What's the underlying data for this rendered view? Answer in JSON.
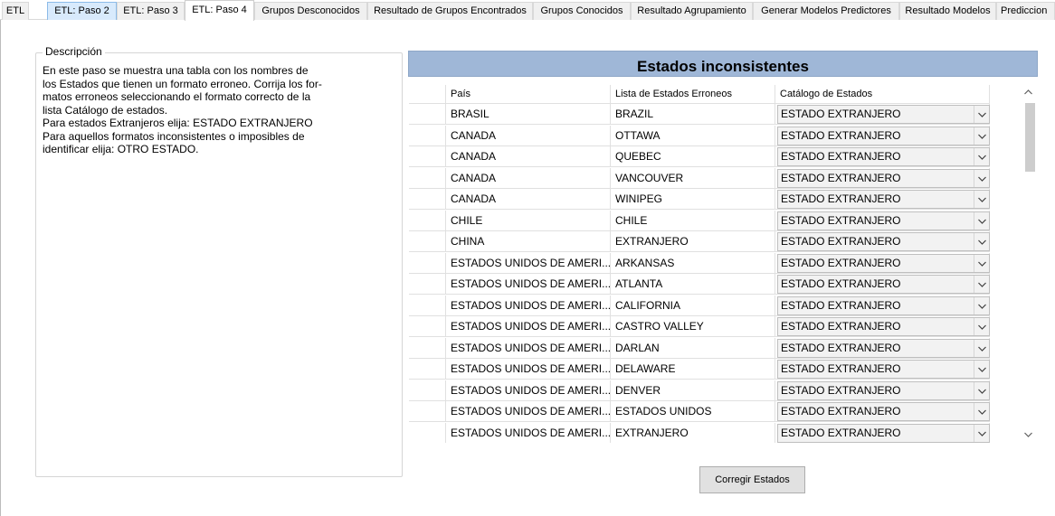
{
  "tabs": [
    {
      "label": "ETL"
    },
    {
      "label": "ETL: Paso 2"
    },
    {
      "label": "ETL: Paso 3"
    },
    {
      "label": "ETL: Paso 4"
    },
    {
      "label": "Grupos Desconocidos"
    },
    {
      "label": "Resultado de Grupos Encontrados"
    },
    {
      "label": "Grupos Conocidos"
    },
    {
      "label": "Resultado Agrupamiento"
    },
    {
      "label": "Generar Modelos Predictores"
    },
    {
      "label": "Resultado Modelos"
    },
    {
      "label": "Prediccion"
    }
  ],
  "description": {
    "legend": "Descripción",
    "lines": [
      "En este  paso se muestra una tabla con los nombres de",
      "los Estados que tienen un formato erroneo. Corrija los for-",
      "matos erroneos seleccionando el formato correcto de la",
      "lista Catálogo de estados.",
      "Para estados Extranjeros elija: ESTADO EXTRANJERO",
      "Para aquellos formatos inconsistentes o imposibles de",
      "identificar elija: OTRO ESTADO."
    ]
  },
  "grid": {
    "title": "Estados inconsistentes",
    "columns": [
      "País",
      "Lista de Estados Erroneos",
      "Catálogo de Estados"
    ],
    "rows": [
      {
        "pais": "BRASIL",
        "estado": "BRAZIL",
        "catalogo": "ESTADO EXTRANJERO"
      },
      {
        "pais": "CANADA",
        "estado": "OTTAWA",
        "catalogo": "ESTADO EXTRANJERO"
      },
      {
        "pais": "CANADA",
        "estado": "QUEBEC",
        "catalogo": "ESTADO EXTRANJERO"
      },
      {
        "pais": "CANADA",
        "estado": "VANCOUVER",
        "catalogo": "ESTADO EXTRANJERO"
      },
      {
        "pais": "CANADA",
        "estado": "WINIPEG",
        "catalogo": "ESTADO EXTRANJERO"
      },
      {
        "pais": "CHILE",
        "estado": "CHILE",
        "catalogo": "ESTADO EXTRANJERO"
      },
      {
        "pais": "CHINA",
        "estado": "EXTRANJERO",
        "catalogo": "ESTADO EXTRANJERO"
      },
      {
        "pais": "ESTADOS UNIDOS DE AMERI...",
        "estado": "ARKANSAS",
        "catalogo": "ESTADO EXTRANJERO"
      },
      {
        "pais": "ESTADOS UNIDOS DE AMERI...",
        "estado": "ATLANTA",
        "catalogo": "ESTADO EXTRANJERO"
      },
      {
        "pais": "ESTADOS UNIDOS DE AMERI...",
        "estado": "CALIFORNIA",
        "catalogo": "ESTADO EXTRANJERO"
      },
      {
        "pais": "ESTADOS UNIDOS DE AMERI...",
        "estado": "CASTRO VALLEY",
        "catalogo": "ESTADO EXTRANJERO"
      },
      {
        "pais": "ESTADOS UNIDOS DE AMERI...",
        "estado": "DARLAN",
        "catalogo": "ESTADO EXTRANJERO"
      },
      {
        "pais": "ESTADOS UNIDOS DE AMERI...",
        "estado": "DELAWARE",
        "catalogo": "ESTADO EXTRANJERO"
      },
      {
        "pais": "ESTADOS UNIDOS DE AMERI...",
        "estado": "DENVER",
        "catalogo": "ESTADO EXTRANJERO"
      },
      {
        "pais": "ESTADOS UNIDOS DE AMERI...",
        "estado": "ESTADOS UNIDOS",
        "catalogo": "ESTADO EXTRANJERO"
      },
      {
        "pais": "ESTADOS UNIDOS DE AMERI...",
        "estado": "EXTRANJERO",
        "catalogo": "ESTADO EXTRANJERO"
      }
    ]
  },
  "buttons": {
    "corregir": "Corregir Estados"
  },
  "icons": {
    "dropdown": "chevron-down-icon",
    "scroll_up": "chevron-up-icon",
    "scroll_down": "chevron-down-icon"
  },
  "colors": {
    "title_bar": "#9fb7d7",
    "combo_bg": "#f2f2f2",
    "button_bg": "#e1e1e1"
  }
}
